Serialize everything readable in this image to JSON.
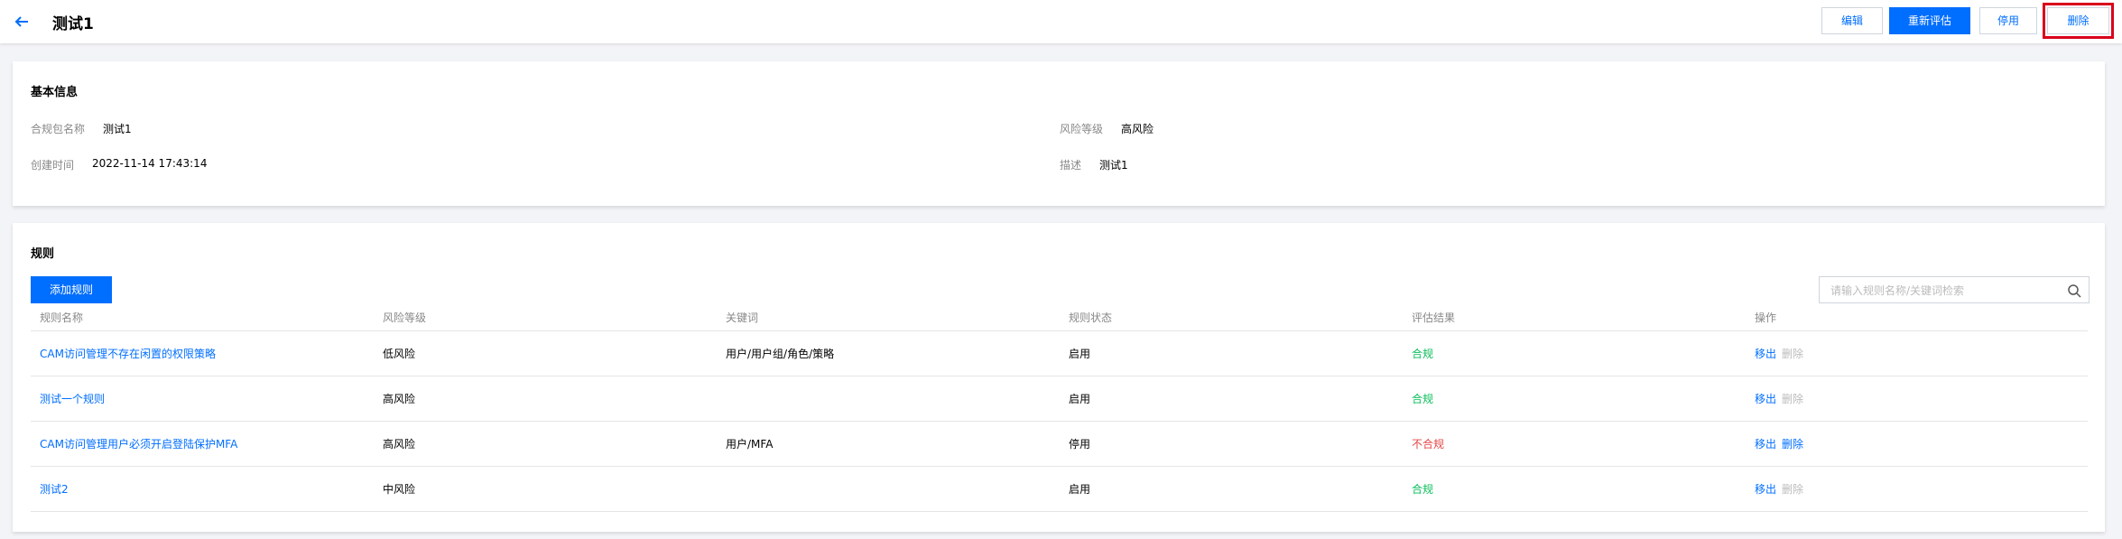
{
  "header": {
    "title": "测试1",
    "buttons": {
      "edit": "编辑",
      "reevaluate": "重新评估",
      "disable": "停用",
      "delete": "删除"
    }
  },
  "basic_info": {
    "section_title": "基本信息",
    "package_name_label": "合规包名称",
    "package_name": "测试1",
    "risk_level_label": "风险等级",
    "risk_level": "高风险",
    "created_time_label": "创建时间",
    "created_time": "2022-11-14 17:43:14",
    "description_label": "描述",
    "description": "测试1"
  },
  "rules": {
    "section_title": "规则",
    "add_button": "添加规则",
    "search_placeholder": "请输入规则名称/关键词检索",
    "columns": [
      "规则名称",
      "风险等级",
      "关键词",
      "规则状态",
      "评估结果",
      "操作"
    ],
    "rows": [
      {
        "name": "CAM访问管理不存在闲置的权限策略",
        "risk": "低风险",
        "keywords": "用户/用户组/角色/策略",
        "status": "启用",
        "result": "合规",
        "result_type": "ok",
        "move": "移出",
        "delete": "删除",
        "delete_enabled": false
      },
      {
        "name": "测试一个规则",
        "risk": "高风险",
        "keywords": "",
        "status": "启用",
        "result": "合规",
        "result_type": "ok",
        "move": "移出",
        "delete": "删除",
        "delete_enabled": false
      },
      {
        "name": "CAM访问管理用户必须开启登陆保护MFA",
        "risk": "高风险",
        "keywords": "用户/MFA",
        "status": "停用",
        "result": "不合规",
        "result_type": "bad",
        "move": "移出",
        "delete": "删除",
        "delete_enabled": true
      },
      {
        "name": "测试2",
        "risk": "中风险",
        "keywords": "",
        "status": "启用",
        "result": "合规",
        "result_type": "ok",
        "move": "移出",
        "delete": "删除",
        "delete_enabled": false
      }
    ]
  },
  "colors": {
    "primary": "#006eff",
    "success": "#0abf5b",
    "danger": "#e54545",
    "highlight_box": "#d9001b"
  },
  "icons": {
    "back": "arrow-left-icon",
    "search": "search-icon"
  }
}
